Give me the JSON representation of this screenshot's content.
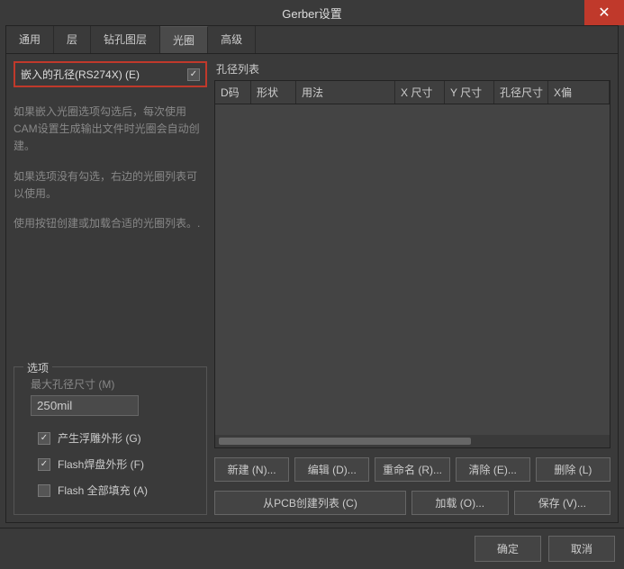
{
  "title": "Gerber设置",
  "tabs": [
    "通用",
    "层",
    "钻孔图层",
    "光圈",
    "高级"
  ],
  "activeTab": 3,
  "embed": {
    "label": "嵌入的孔径(RS274X) (E)",
    "checked": true
  },
  "help": [
    "如果嵌入光圈选项勾选后，每次使用CAM设置生成输出文件时光圈会自动创建。",
    "如果选项没有勾选，右边的光圈列表可以使用。",
    "使用按钮创建或加载合适的光圈列表。."
  ],
  "options": {
    "title": "选项",
    "maxLabel": "最大孔径尺寸 (M)",
    "maxValue": "250mil",
    "relief": {
      "label": "产生浮雕外形 (G)",
      "checked": true
    },
    "flashPad": {
      "label": "Flash焊盘外形 (F)",
      "checked": true
    },
    "flashFill": {
      "label": "Flash 全部填充 (A)",
      "checked": false
    }
  },
  "table": {
    "title": "孔径列表",
    "cols": [
      "D码",
      "形状",
      "用法",
      "X 尺寸",
      "Y 尺寸",
      "孔径尺寸",
      "X偏"
    ]
  },
  "buttons": {
    "new": "新建 (N)...",
    "edit": "编辑 (D)...",
    "rename": "重命名 (R)...",
    "clear": "清除 (E)...",
    "delete": "删除 (L)",
    "fromPCB": "从PCB创建列表 (C)",
    "load": "加载 (O)...",
    "save": "保存 (V)..."
  },
  "footer": {
    "ok": "确定",
    "cancel": "取消"
  }
}
